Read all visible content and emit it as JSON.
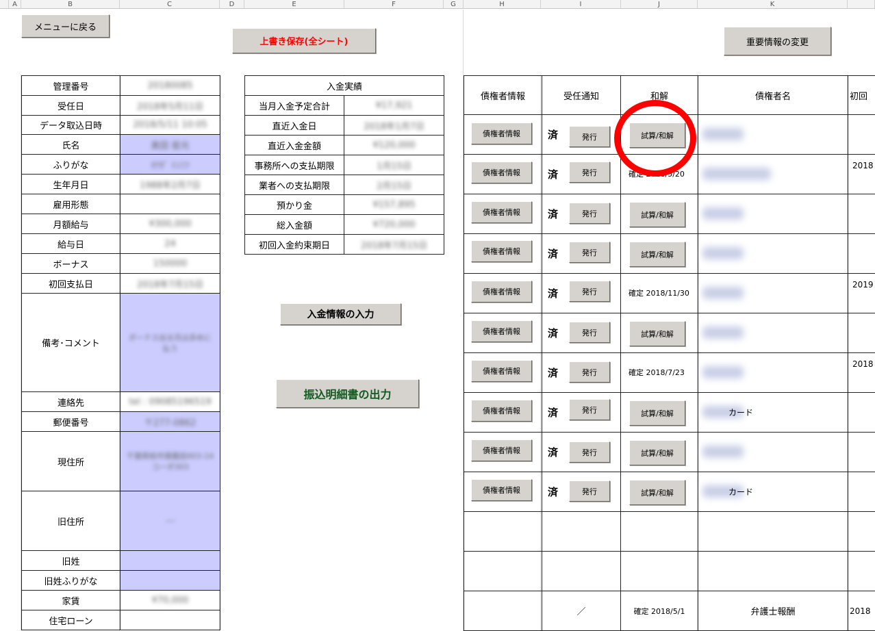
{
  "columns": [
    "A",
    "B",
    "C",
    "D",
    "E",
    "F",
    "G",
    "H",
    "I",
    "J",
    "K"
  ],
  "buttons": {
    "menu": "メニューに戻る",
    "save_all": "上書き保存(全シート)",
    "important_change": "重要情報の変更",
    "payment_input": "入金情報の入力",
    "transfer_output": "振込明細書の出力",
    "creditor_info": "債権者情報",
    "issue": "発行",
    "calc_settle": "試算/和解"
  },
  "colors": {
    "save_all_text": "#ff0000",
    "transfer_output_text": "#0f5a1e",
    "lavender_cell": "#ccccff",
    "annotation_circle": "#ff0000"
  },
  "info_table": [
    {
      "label": "管理番号",
      "value": "20180085",
      "lav": false
    },
    {
      "label": "受任日",
      "value": "2018年5月11日",
      "lav": false
    },
    {
      "label": "データ取込日時",
      "value": "2018/5/11 10:05",
      "lav": false
    },
    {
      "label": "氏名",
      "value": "奥田 俊光",
      "lav": true
    },
    {
      "label": "ふりがな",
      "value": "ｵｸﾀﾞ ﾄｼﾐﾂ",
      "lav": true
    },
    {
      "label": "生年月日",
      "value": "1988年2月7日",
      "lav": false
    },
    {
      "label": "雇用形態",
      "value": "",
      "lav": false
    },
    {
      "label": "月額給与",
      "value": "¥300,000",
      "lav": false
    },
    {
      "label": "給与日",
      "value": "24",
      "lav": false
    },
    {
      "label": "ボーナス",
      "value": "150000",
      "lav": false
    },
    {
      "label": "初回支払日",
      "value": "2018年7月15日",
      "lav": false
    },
    {
      "label": "備考･コメント",
      "value": "ボーナス出る月は多めに払う",
      "lav": true
    },
    {
      "label": "連絡先",
      "value": "tel : 09085196519",
      "lav": false
    },
    {
      "label": "郵便番号",
      "value": "〒277-0862",
      "lav": true
    },
    {
      "label": "現住所",
      "value": "千葉県柏市篠籠田403-14 コーポ303",
      "lav": true
    },
    {
      "label": "旧住所",
      "value": "---",
      "lav": true
    },
    {
      "label": "旧姓",
      "value": "",
      "lav": true
    },
    {
      "label": "旧姓ふりがな",
      "value": "",
      "lav": true
    },
    {
      "label": "家賃",
      "value": "¥70,000",
      "lav": false
    },
    {
      "label": "住宅ローン",
      "value": "",
      "lav": false
    }
  ],
  "payment": {
    "header": "入金実績",
    "rows": [
      {
        "label": "当月入金予定合計",
        "value": "¥17,921"
      },
      {
        "label": "直近入金日",
        "value": "2018年1月7日"
      },
      {
        "label": "直近入金金額",
        "value": "¥120,000"
      },
      {
        "label": "事務所への支払期限",
        "value": "1月15日"
      },
      {
        "label": "業者への支払期限",
        "value": "2月15日"
      },
      {
        "label": "預かり金",
        "value": "¥157,895"
      },
      {
        "label": "総入金額",
        "value": "¥720,000"
      },
      {
        "label": "初回入金約束期日",
        "value": "2018年7月15日"
      }
    ]
  },
  "creditor_table": {
    "headers": [
      "債権者情報",
      "受任通知",
      "和解",
      "債権者名",
      "初回"
    ],
    "rows": [
      {
        "notice": "済",
        "settle": "",
        "name": "",
        "first": ""
      },
      {
        "notice": "済",
        "settle": "確定 2018/5/20",
        "name": "",
        "first": "2018"
      },
      {
        "notice": "済",
        "settle": "",
        "name": "",
        "first": ""
      },
      {
        "notice": "済",
        "settle": "",
        "name": "",
        "first": ""
      },
      {
        "notice": "済",
        "settle": "確定 2018/11/30",
        "name": "",
        "first": "2019"
      },
      {
        "notice": "済",
        "settle": "",
        "name": "",
        "first": ""
      },
      {
        "notice": "済",
        "settle": "確定 2018/7/23",
        "name": "",
        "first": "2018"
      },
      {
        "notice": "済",
        "settle": "",
        "name": "カード",
        "first": ""
      },
      {
        "notice": "済",
        "settle": "",
        "name": "",
        "first": ""
      },
      {
        "notice": "済",
        "settle": "",
        "name": "カード",
        "first": ""
      }
    ],
    "footer": {
      "notice": "／",
      "settle": "確定 2018/5/1",
      "name": "弁護士報酬",
      "first": "2018"
    }
  }
}
